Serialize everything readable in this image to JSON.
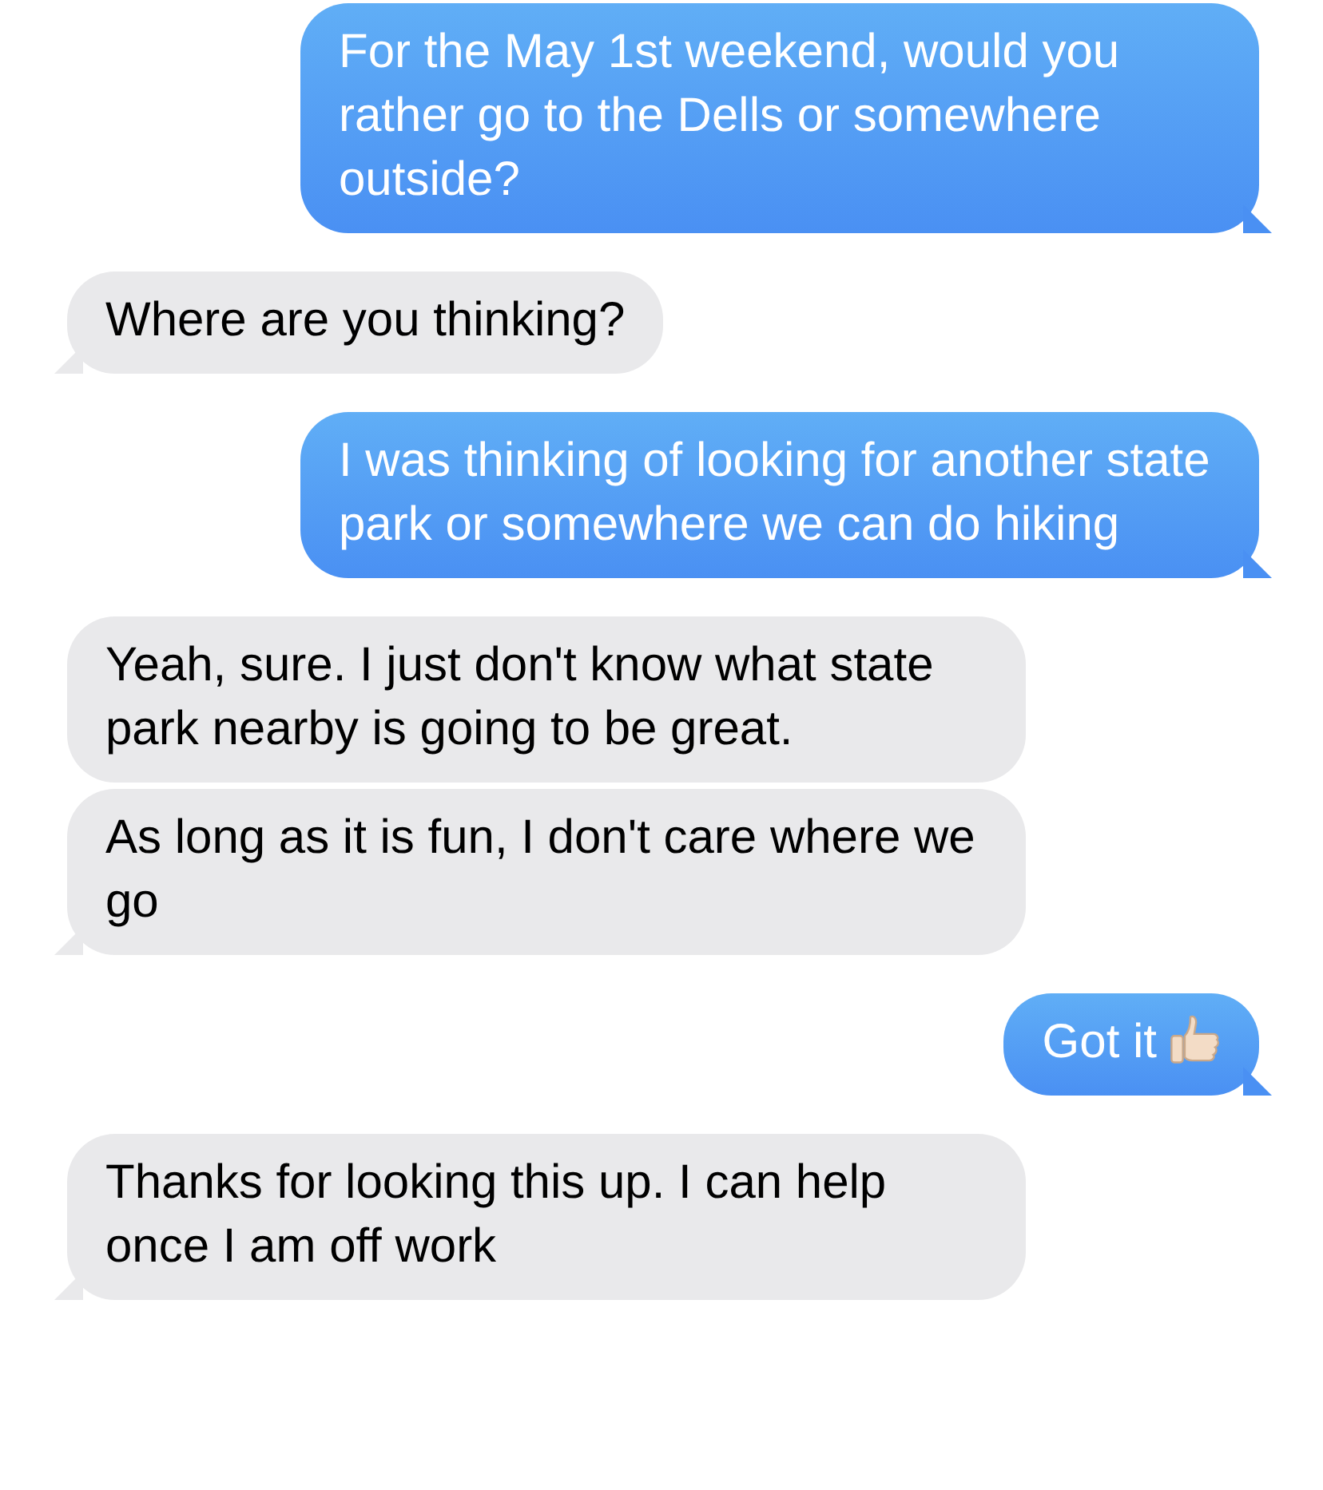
{
  "messages": [
    {
      "kind": "sent",
      "text": "For the May 1st weekend, would you rather go to the Dells or somewhere outside?"
    },
    {
      "kind": "received",
      "text": "Where are you thinking?"
    },
    {
      "kind": "sent",
      "text": "I was thinking of looking for another state park or somewhere we can do hiking"
    },
    {
      "kind": "received",
      "text": "Yeah, sure. I just don't know what state park nearby is going to be great."
    },
    {
      "kind": "received",
      "text": "As long as it is fun, I don't care where we go"
    },
    {
      "kind": "thumbsup",
      "text": "Got it"
    },
    {
      "kind": "received",
      "text": "Thanks for looking this up. I can help once I am off work"
    }
  ]
}
